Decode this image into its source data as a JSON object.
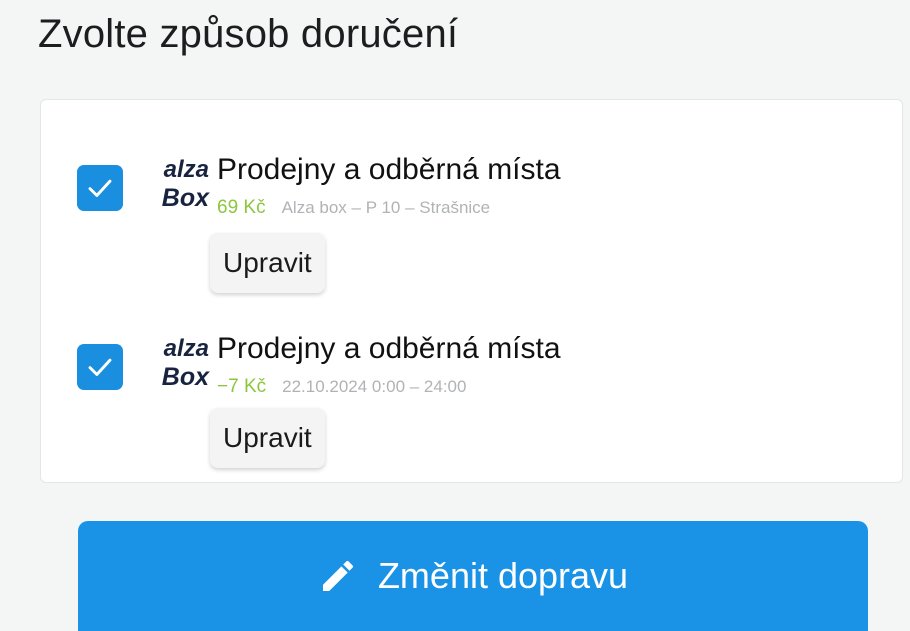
{
  "page": {
    "title": "Zvolte způsob doručení"
  },
  "delivery_options": [
    {
      "logo_line1": "alza",
      "logo_line2": "Box",
      "title": "Prodejny a odběrná místa",
      "price": "69 Kč",
      "detail": "Alza box – P 10 – Strašnice",
      "edit_label": "Upravit",
      "checked": true
    },
    {
      "logo_line1": "alza",
      "logo_line2": "Box",
      "title": "Prodejny a odběrná místa",
      "price": "−7 Kč",
      "detail": "22.10.2024 0:00 – 24:00",
      "edit_label": "Upravit",
      "checked": true
    }
  ],
  "actions": {
    "change_delivery_label": "Změnit dopravu"
  },
  "colors": {
    "accent": "#1a93e6",
    "checkbox": "#1a8fe0",
    "price": "#8cc63f",
    "detail": "#b0b3b6",
    "logo": "#17233f"
  },
  "icons": {
    "checkbox": "check-icon",
    "change_button": "pencil-icon"
  }
}
